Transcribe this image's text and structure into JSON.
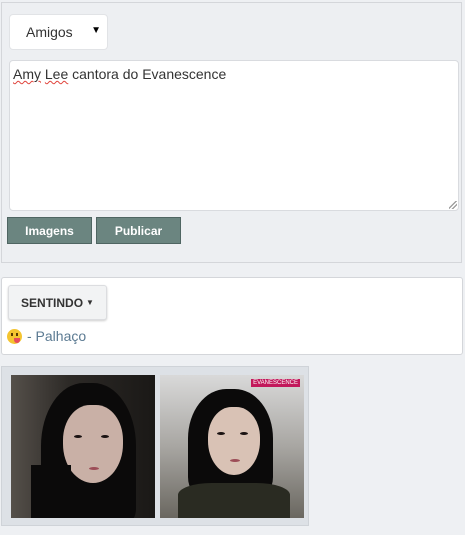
{
  "composer": {
    "audience": "Amigos",
    "post_text_before": "",
    "post_text_word1": "Amy",
    "post_text_word2": "Lee",
    "post_text_rest": "cantora do Evanescence",
    "images_button": "Imagens",
    "publish_button": "Publicar"
  },
  "mood": {
    "button_label": "SENTINDO",
    "feeling_text": "- Palhaço"
  },
  "gallery": {
    "photos": [
      "photo-1",
      "photo-2"
    ],
    "photo2_tag": "EVANESCENCE"
  },
  "colors": {
    "button_green": "#6b8580",
    "link_blue": "#5b7a92"
  }
}
